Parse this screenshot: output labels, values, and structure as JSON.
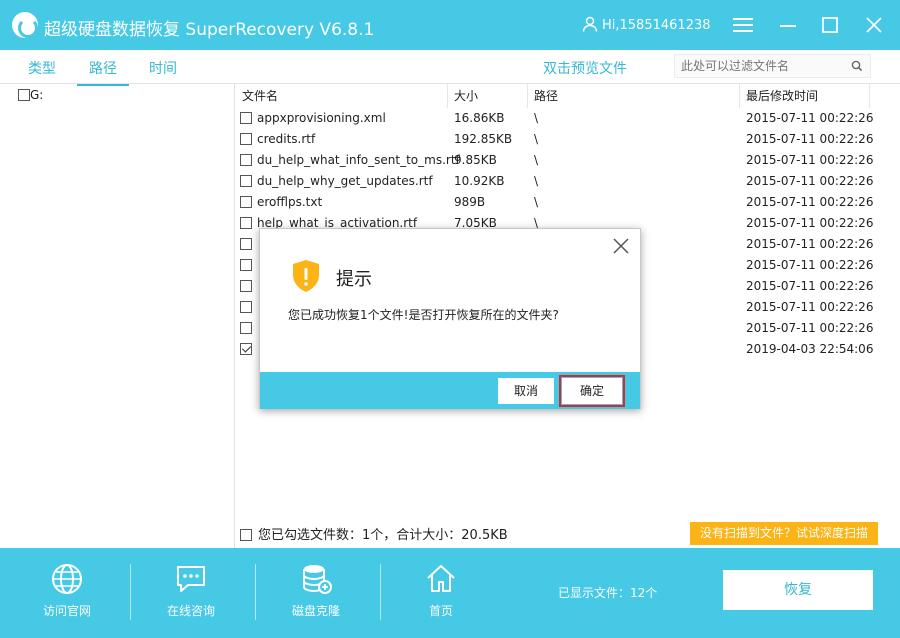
{
  "app": {
    "title": "超级硬盘数据恢复 SuperRecovery V6.8.1",
    "user": "Hi,15851461238"
  },
  "tabs": [
    "类型",
    "路径",
    "时间"
  ],
  "toolbar": {
    "preview_link": "双击预览文件",
    "search_placeholder": "此处可以过滤文件名"
  },
  "tree": {
    "drive": "G:"
  },
  "table": {
    "headers": [
      "文件名",
      "大小",
      "路径",
      "最后修改时间"
    ],
    "rows": [
      {
        "name": "appxprovisioning.xml",
        "size": "16.86KB",
        "path": "\\",
        "date": "2015-07-11 00:22:26",
        "checked": false
      },
      {
        "name": "credits.rtf",
        "size": "192.85KB",
        "path": "\\",
        "date": "2015-07-11 00:22:26",
        "checked": false
      },
      {
        "name": "du_help_what_info_sent_to_ms.rtf",
        "size": "9.85KB",
        "path": "\\",
        "date": "2015-07-11 00:22:26",
        "checked": false
      },
      {
        "name": "du_help_why_get_updates.rtf",
        "size": "10.92KB",
        "path": "\\",
        "date": "2015-07-11 00:22:26",
        "checked": false
      },
      {
        "name": "erofflps.txt",
        "size": "989B",
        "path": "\\",
        "date": "2015-07-11 00:22:26",
        "checked": false
      },
      {
        "name": "help_what_is_activation.rtf",
        "size": "7.05KB",
        "path": "\\",
        "date": "2015-07-11 00:22:26",
        "checked": false
      },
      {
        "name": "",
        "size": "",
        "path": "",
        "date": "2015-07-11 00:22:26",
        "checked": false
      },
      {
        "name": "",
        "size": "",
        "path": "",
        "date": "2015-07-11 00:22:26",
        "checked": false
      },
      {
        "name": "",
        "size": "",
        "path": "",
        "date": "2015-07-11 00:22:26",
        "checked": false
      },
      {
        "name": "",
        "size": "",
        "path": "",
        "date": "2015-07-11 00:22:26",
        "checked": false
      },
      {
        "name": "",
        "size": "",
        "path": "",
        "date": "2015-07-11 00:22:26",
        "checked": false
      },
      {
        "name": "",
        "size": "",
        "path": "",
        "date": "2019-04-03 22:54:06",
        "checked": true
      }
    ]
  },
  "status": {
    "summary": "您已勾选文件数：1个，合计大小：20.5KB",
    "deep_scan": "没有扫描到文件？试试深度扫描"
  },
  "bottom": {
    "nav": [
      "访问官网",
      "在线咨询",
      "磁盘克隆",
      "首页"
    ],
    "shown": "已显示文件：12个",
    "recover": "恢复"
  },
  "dialog": {
    "title": "提示",
    "message": "您已成功恢复1个文件!是否打开恢复所在的文件夹?",
    "cancel": "取消",
    "ok": "确定"
  },
  "colors": {
    "accent": "#45c9e4",
    "warning": "#fbb316",
    "highlight": "#e0262b"
  }
}
